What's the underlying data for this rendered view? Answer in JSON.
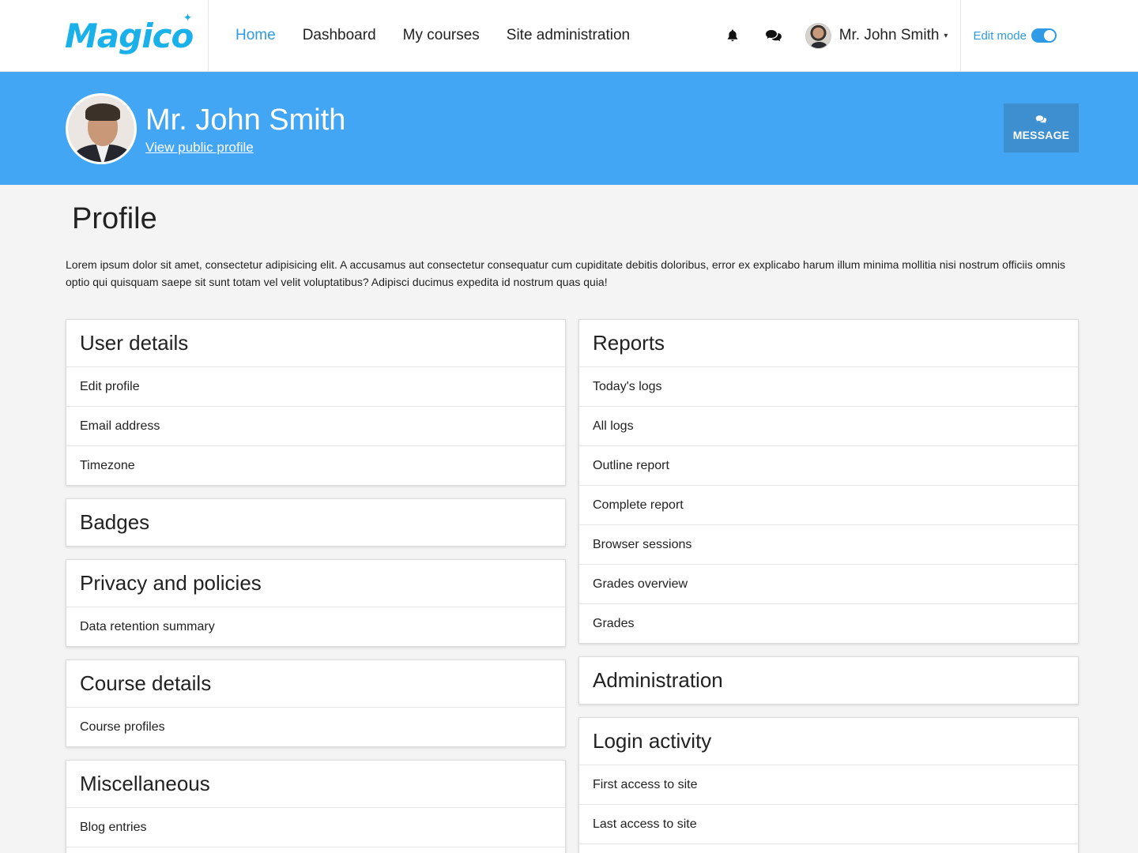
{
  "brand": {
    "logo_text": "Magico",
    "accent": "#1ab0ea"
  },
  "nav": {
    "items": [
      "Home",
      "Dashboard",
      "My courses",
      "Site administration"
    ],
    "active": "Home"
  },
  "tools": {
    "notifications_icon": "bell-icon",
    "messages_icon": "chat-icon"
  },
  "user_menu": {
    "name": "Mr. John Smith",
    "caret": "▾"
  },
  "edit_mode": {
    "label": "Edit mode",
    "enabled": true
  },
  "banner": {
    "name": "Mr. John Smith",
    "link": "View public profile",
    "message_button": "MESSAGE",
    "bg_color": "#43a6f4"
  },
  "page": {
    "title": "Profile",
    "intro": "Lorem ipsum dolor sit amet, consectetur adipisicing elit. A accusamus aut consectetur consequatur cum cupiditate debitis doloribus, error ex explicabo harum illum minima mollitia nisi nostrum officiis omnis optio qui quisquam saepe sit sunt totam vel velit voluptatibus? Adipisci ducimus expedita id nostrum quas quia!"
  },
  "left_cards": [
    {
      "title": "User details",
      "items": [
        "Edit profile",
        "Email address",
        "Timezone"
      ]
    },
    {
      "title": "Badges",
      "items": []
    },
    {
      "title": "Privacy and policies",
      "items": [
        "Data retention summary"
      ]
    },
    {
      "title": "Course details",
      "items": [
        "Course profiles"
      ]
    },
    {
      "title": "Miscellaneous",
      "items": [
        "Blog entries",
        ""
      ]
    }
  ],
  "right_cards": [
    {
      "title": "Reports",
      "items": [
        "Today's logs",
        "All logs",
        "Outline report",
        "Complete report",
        "Browser sessions",
        "Grades overview",
        "Grades"
      ]
    },
    {
      "title": "Administration",
      "items": []
    },
    {
      "title": "Login activity",
      "items": [
        "First access to site",
        "Last access to site",
        ""
      ]
    }
  ]
}
